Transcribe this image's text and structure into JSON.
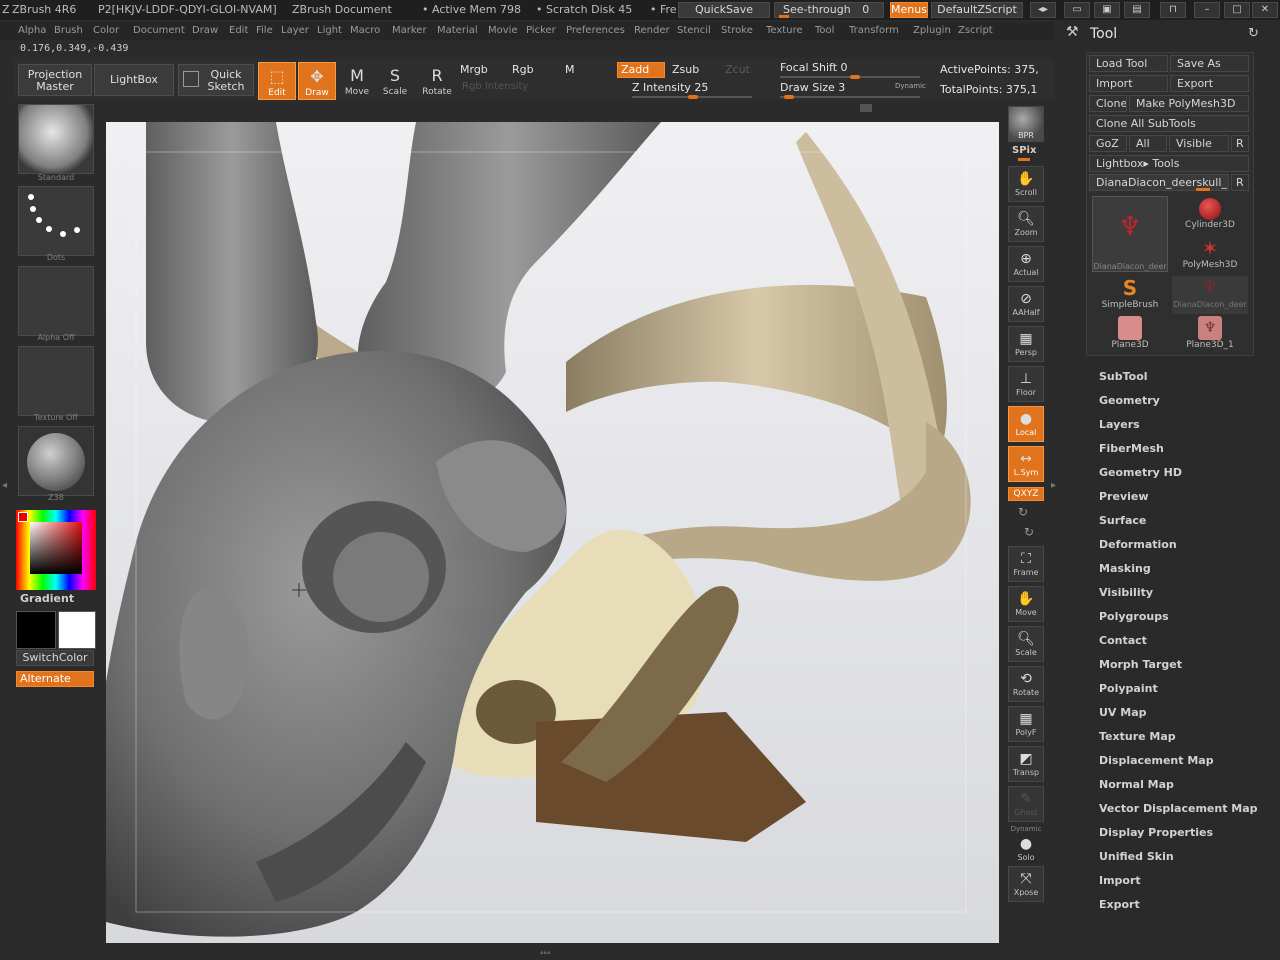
{
  "titlebar": {
    "app": "ZBrush 4R6",
    "license": "P2[HKJV-LDDF-QDYI-GLOI-NVAM]",
    "document": "ZBrush Document",
    "active_mem": "• Active Mem 798",
    "scratch_disk": "• Scratch Disk 45",
    "free": "• Fre",
    "quicksave": "QuickSave",
    "see_through": "See-through",
    "see_through_value": "0",
    "menus": "Menus",
    "script": "DefaultZScript"
  },
  "menubar": {
    "items": [
      "Alpha",
      "Brush",
      "Color",
      "Document",
      "Draw",
      "Edit",
      "File",
      "Layer",
      "Light",
      "Macro",
      "Marker",
      "Material",
      "Movie",
      "Picker",
      "Preferences",
      "Render",
      "Stencil",
      "Stroke",
      "Texture",
      "Tool",
      "Transform",
      "Zplugin",
      "Zscript"
    ]
  },
  "coords": "0.176,0.349,-0.439",
  "shelf": {
    "projection_master": "Projection Master",
    "lightbox": "LightBox",
    "quick_sketch": "Quick Sketch",
    "edit": "Edit",
    "draw": "Draw",
    "move": "Move",
    "scale": "Scale",
    "rotate": "Rotate",
    "mrgb": "Mrgb",
    "rgb": "Rgb",
    "m": "M",
    "zadd": "Zadd",
    "zsub": "Zsub",
    "zcut": "Zcut",
    "rgb_intensity": "Rgb Intensity",
    "z_intensity": "Z Intensity 25",
    "focal_shift": "Focal Shift 0",
    "draw_size": "Draw Size 3",
    "dynamic": "Dynamic",
    "active_points": "ActivePoints: 375,",
    "total_points": "TotalPoints: 375,1"
  },
  "leftpanel": {
    "brush": "Standard",
    "stroke": "Dots",
    "alpha": "Alpha  Off",
    "texture": "Texture  Off",
    "material": "Z38",
    "gradient": "Gradient",
    "switch_color": "SwitchColor",
    "alternate": "Alternate"
  },
  "rightshelf": {
    "bpr": "BPR",
    "spix": "SPix",
    "scroll": "Scroll",
    "zoom": "Zoom",
    "actual": "Actual",
    "aahalf": "AAHalf",
    "persp": "Persp",
    "floor": "Floor",
    "local": "Local",
    "lsym": "L.Sym",
    "xyz": "QXYZ",
    "frame": "Frame",
    "move": "Move",
    "scale": "Scale",
    "rotate": "Rotate",
    "polyf": "PolyF",
    "transp": "Transp",
    "ghost": "Ghost",
    "dynamic": "Dynamic",
    "solo": "Solo",
    "xpose": "Xpose"
  },
  "toolpanel": {
    "title": "Tool",
    "load_tool": "Load Tool",
    "save_as": "Save As",
    "import": "Import",
    "export": "Export",
    "clone": "Clone",
    "make_polymesh": "Make PolyMesh3D",
    "clone_all": "Clone  All SubTools",
    "goz": "GoZ",
    "all": "All",
    "visible": "Visible",
    "r": "R",
    "lightbox_tools": "Lightbox▸ Tools",
    "current_tool": "DianaDiacon_deerskull_",
    "tools": [
      {
        "label": "DianaDiacon_deer"
      },
      {
        "label": "Cylinder3D"
      },
      {
        "label": "PolyMesh3D"
      },
      {
        "label": "SimpleBrush"
      },
      {
        "label": "DianaDiacon_deer"
      },
      {
        "label": "Plane3D"
      },
      {
        "label": "Plane3D_1"
      }
    ],
    "sections": [
      "SubTool",
      "Geometry",
      "Layers",
      "FiberMesh",
      "Geometry HD",
      "Preview",
      "Surface",
      "Deformation",
      "Masking",
      "Visibility",
      "Polygroups",
      "Contact",
      "Morph Target",
      "Polypaint",
      "UV Map",
      "Texture Map",
      "Displacement Map",
      "Normal Map",
      "Vector Displacement Map",
      "Display Properties",
      "Unified Skin",
      "Import",
      "Export"
    ]
  },
  "colors": {
    "accent": "#e0731b",
    "bg": "#2b2b2b",
    "canvas": "#e6e7ea",
    "primary_color": "#000000",
    "secondary_color": "#ffffff"
  }
}
